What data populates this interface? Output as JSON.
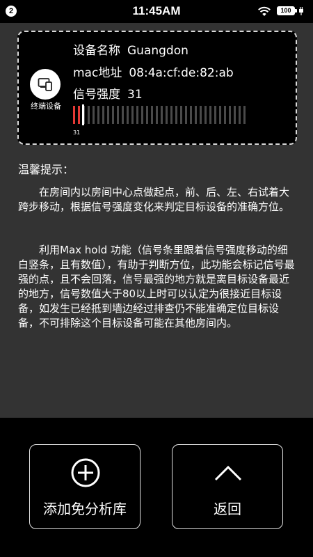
{
  "status_bar": {
    "notification_count": "2",
    "time": "11:45AM",
    "battery_level": "100"
  },
  "device_card": {
    "avatar_caption": "终端设备",
    "name_label": "设备名称",
    "name_value": "Guangdon",
    "mac_label": "mac地址",
    "mac_value": "08:4a:cf:de:82:ab",
    "signal_label": "信号强度",
    "signal_value": "31",
    "signal_max_hold": "31",
    "signal_level_fraction": 0.06,
    "colors": {
      "signal_active": "#e53935",
      "signal_inactive": "#4a4a4a",
      "max_hold_marker": "#ffffff"
    }
  },
  "tips": {
    "title": "温馨提示：",
    "paragraph1": "在房间内以房间中心点做起点，前、后、左、右试着大跨步移动，根据信号强度变化来判定目标设备的准确方位。",
    "paragraph2": "利用Max hold 功能（信号条里跟着信号强度移动的细白竖条，且有数值），有助于判断方位，此功能会标记信号最强的点，且不会回落，信号最强的地方就是离目标设备最近的地方，信号数值大于80以上时可以认定为很接近目标设备，如发生已经抵到墙边经过排查仍不能准确定位目标设备，不可排除这个目标设备可能在其他房间内。"
  },
  "actions": {
    "add_label": "添加免分析库",
    "back_label": "返回"
  }
}
